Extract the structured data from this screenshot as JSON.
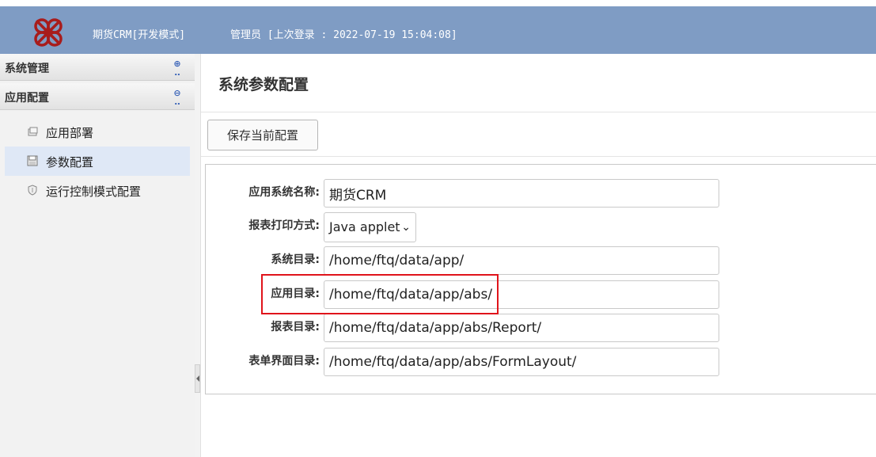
{
  "header": {
    "app_title": "期货CRM[开发模式]",
    "user_info": "管理员 [上次登录 : 2022-07-19 15:04:08]"
  },
  "sidebar": {
    "panels": [
      {
        "label": "系统管理",
        "toggle": "plus-icon"
      },
      {
        "label": "应用配置",
        "toggle": "minus-icon"
      }
    ],
    "items": [
      {
        "label": "应用部署",
        "icon": "deploy-icon",
        "active": false
      },
      {
        "label": "参数配置",
        "icon": "save-icon",
        "active": true
      },
      {
        "label": "运行控制模式配置",
        "icon": "shield-icon",
        "active": false
      }
    ]
  },
  "main": {
    "title": "系统参数配置",
    "save_label": "保存当前配置",
    "fields": [
      {
        "label": "应用系统名称:",
        "value": "期货CRM"
      },
      {
        "label": "报表打印方式:",
        "value": "Java applet"
      },
      {
        "label": "系统目录:",
        "value": "/home/ftq/data/app/"
      },
      {
        "label": "应用目录:",
        "value": "/home/ftq/data/app/abs/"
      },
      {
        "label": "报表目录:",
        "value": "/home/ftq/data/app/abs/Report/"
      },
      {
        "label": "表单界面目录:",
        "value": "/home/ftq/data/app/abs/FormLayout/"
      }
    ]
  },
  "colors": {
    "header_bg": "#7f9cc4",
    "active_nav_bg": "#dfe8f6",
    "highlight_border": "#e0141b",
    "logo": "#a81c1c"
  }
}
